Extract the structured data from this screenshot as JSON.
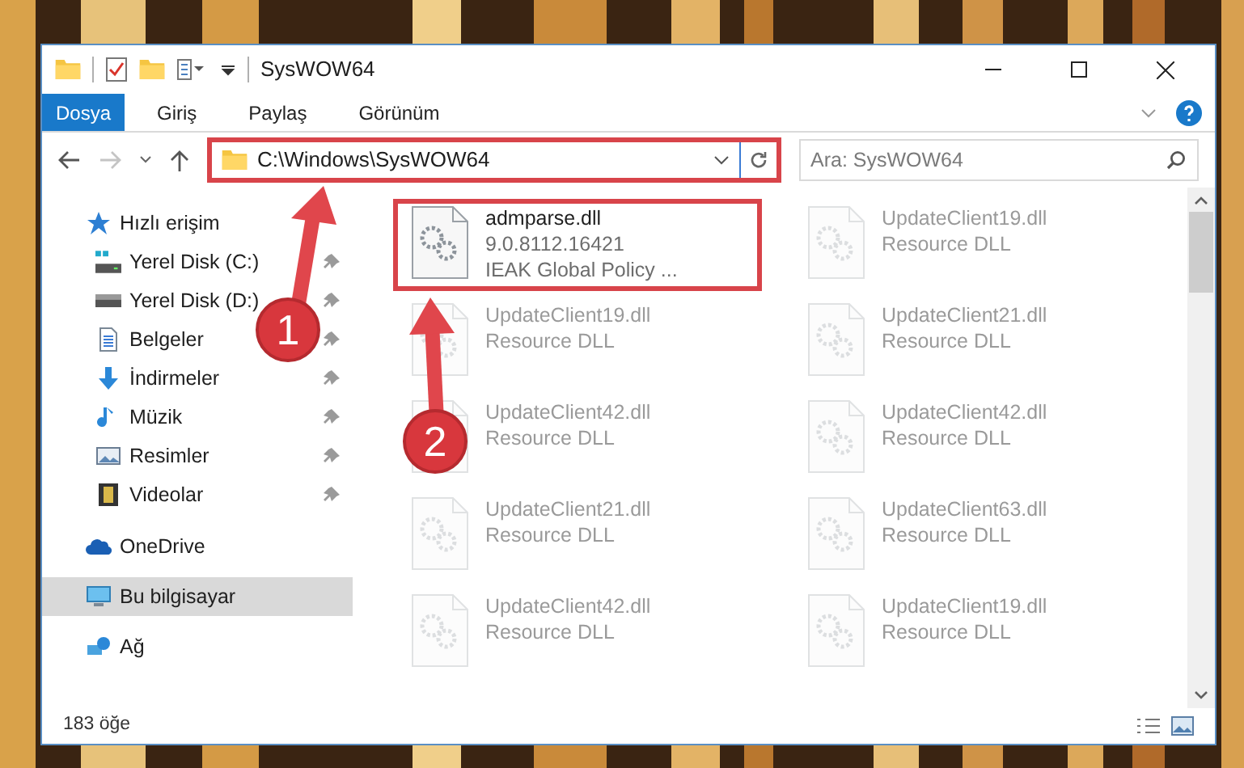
{
  "window": {
    "title": "SysWOW64"
  },
  "ribbon_tabs": [
    {
      "label": "Dosya",
      "kind": "file"
    },
    {
      "label": "Giriş",
      "kind": "tab"
    },
    {
      "label": "Paylaş",
      "kind": "tab"
    },
    {
      "label": "Görünüm",
      "kind": "tab"
    }
  ],
  "address": {
    "path": "C:\\Windows\\SysWOW64",
    "highlighted": true
  },
  "search": {
    "placeholder": "Ara: SysWOW64"
  },
  "sidebar": {
    "items": [
      {
        "label": "Hızlı erişim",
        "kind": "star",
        "selected": false,
        "children": [
          {
            "label": "Yerel Disk (C:)",
            "kind": "system-drive",
            "pinned": true,
            "selected": false
          },
          {
            "label": "Yerel Disk (D:)",
            "kind": "drive",
            "pinned": true,
            "selected": false
          },
          {
            "label": "Belgeler",
            "kind": "documents",
            "pinned": true,
            "selected": false
          },
          {
            "label": "İndirmeler",
            "kind": "downloads",
            "pinned": true,
            "selected": false
          },
          {
            "label": "Müzik",
            "kind": "music",
            "pinned": true,
            "selected": false
          },
          {
            "label": "Resimler",
            "kind": "pictures",
            "pinned": true,
            "selected": false
          },
          {
            "label": "Videolar",
            "kind": "videos",
            "pinned": true,
            "selected": false
          }
        ]
      },
      {
        "label": "OneDrive",
        "kind": "cloud",
        "selected": false
      },
      {
        "label": "Bu bilgisayar",
        "kind": "computer",
        "selected": true
      },
      {
        "label": "Ağ",
        "kind": "network",
        "selected": false
      }
    ]
  },
  "files": [
    {
      "name": "admparse.dll",
      "version": "9.0.8112.16421",
      "description": "IEAK Global Policy ...",
      "faded": false,
      "highlighted": true
    },
    {
      "name": "UpdateClient19.dll",
      "description": "Resource DLL",
      "faded": true,
      "highlighted": false
    },
    {
      "name": "UpdateClient19.dll",
      "description": "Resource DLL",
      "faded": true,
      "highlighted": false
    },
    {
      "name": "UpdateClient21.dll",
      "description": "Resource DLL",
      "faded": true,
      "highlighted": false
    },
    {
      "name": "UpdateClient42.dll",
      "description": "Resource DLL",
      "faded": true,
      "highlighted": false
    },
    {
      "name": "UpdateClient42.dll",
      "description": "Resource DLL",
      "faded": true,
      "highlighted": false
    },
    {
      "name": "UpdateClient21.dll",
      "description": "Resource DLL",
      "faded": true,
      "highlighted": false
    },
    {
      "name": "UpdateClient63.dll",
      "description": "Resource DLL",
      "faded": true,
      "highlighted": false
    },
    {
      "name": "UpdateClient42.dll",
      "description": "Resource DLL",
      "faded": true,
      "highlighted": false
    },
    {
      "name": "UpdateClient19.dll",
      "description": "Resource DLL",
      "faded": true,
      "highlighted": false
    }
  ],
  "status_bar": {
    "item_count": "183 öğe"
  },
  "annotations": [
    {
      "number": "1"
    },
    {
      "number": "2"
    }
  ]
}
